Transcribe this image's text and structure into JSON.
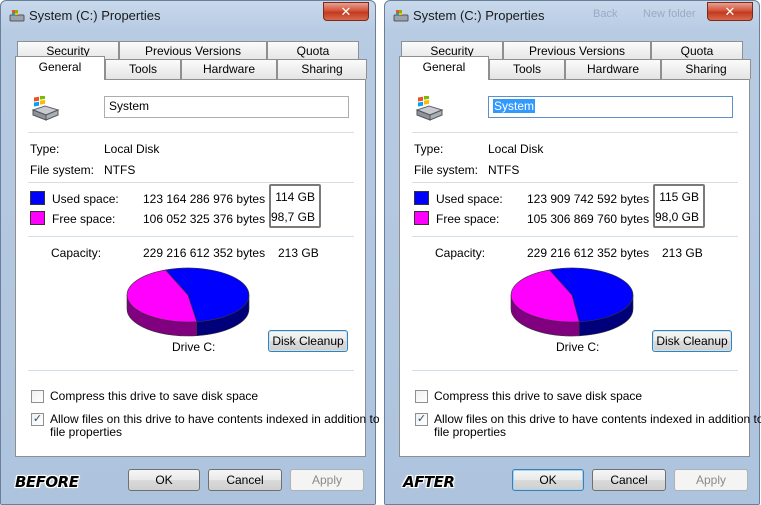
{
  "windows": [
    {
      "title": "System (C:) Properties",
      "close_glyph": "✕",
      "tabs_top": [
        "Security",
        "Previous Versions",
        "Quota"
      ],
      "tabs_bottom": [
        "General",
        "Tools",
        "Hardware",
        "Sharing"
      ],
      "selected_tab": "General",
      "name_value": "System",
      "type_label": "Type:",
      "type_value": "Local Disk",
      "fs_label": "File system:",
      "fs_value": "NTFS",
      "used_label": "Used space:",
      "used_bytes": "123 164 286 976 bytes",
      "used_gb": "114 GB",
      "free_label": "Free space:",
      "free_bytes": "106 052 325 376 bytes",
      "free_gb": "98,7 GB",
      "capacity_label": "Capacity:",
      "capacity_bytes": "229 216 612 352 bytes",
      "capacity_gb": "213 GB",
      "drive_label": "Drive C:",
      "cleanup_label": "Disk Cleanup",
      "compress_label": "Compress this drive to save disk space",
      "compress_checked": false,
      "index_label_1": "Allow files on this drive to have contents indexed in addition to",
      "index_label_2": "file properties",
      "index_checked": true,
      "check_glyph": "✓",
      "ok_label": "OK",
      "cancel_label": "Cancel",
      "apply_label": "Apply",
      "stamp": "BEFORE",
      "used_fraction": 0.537,
      "name_selected": false,
      "ghost_text": []
    },
    {
      "title": "System (C:) Properties",
      "close_glyph": "✕",
      "tabs_top": [
        "Security",
        "Previous Versions",
        "Quota"
      ],
      "tabs_bottom": [
        "General",
        "Tools",
        "Hardware",
        "Sharing"
      ],
      "selected_tab": "General",
      "name_value": "System",
      "type_label": "Type:",
      "type_value": "Local Disk",
      "fs_label": "File system:",
      "fs_value": "NTFS",
      "used_label": "Used space:",
      "used_bytes": "123 909 742 592 bytes",
      "used_gb": "115 GB",
      "free_label": "Free space:",
      "free_bytes": "105 306 869 760 bytes",
      "free_gb": "98,0 GB",
      "capacity_label": "Capacity:",
      "capacity_bytes": "229 216 612 352 bytes",
      "capacity_gb": "213 GB",
      "drive_label": "Drive C:",
      "cleanup_label": "Disk Cleanup",
      "compress_label": "Compress this drive to save disk space",
      "compress_checked": false,
      "index_label_1": "Allow files on this drive to have contents indexed in addition to",
      "index_label_2": "file properties",
      "index_checked": true,
      "check_glyph": "✓",
      "ok_label": "OK",
      "cancel_label": "Cancel",
      "apply_label": "Apply",
      "stamp": "AFTER",
      "used_fraction": 0.541,
      "name_selected": true,
      "ghost_text": [
        "Back",
        "New folder"
      ]
    }
  ],
  "colors": {
    "used": "#0000ff",
    "used_dark": "#00007a",
    "free": "#ff00ff",
    "free_dark": "#800080"
  }
}
